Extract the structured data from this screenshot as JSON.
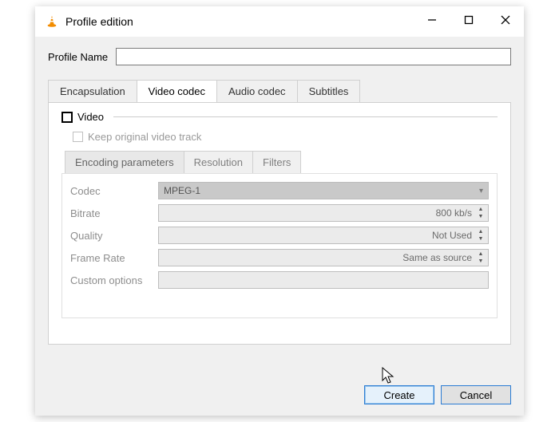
{
  "window": {
    "title": "Profile edition"
  },
  "profile": {
    "label": "Profile Name",
    "value": ""
  },
  "tabs": {
    "encapsulation": "Encapsulation",
    "video_codec": "Video codec",
    "audio_codec": "Audio codec",
    "subtitles": "Subtitles"
  },
  "video": {
    "checkbox_label": "Video",
    "keep_label": "Keep original video track",
    "subtabs": {
      "encoding": "Encoding parameters",
      "resolution": "Resolution",
      "filters": "Filters"
    },
    "params": {
      "codec": {
        "label": "Codec",
        "value": "MPEG-1"
      },
      "bitrate": {
        "label": "Bitrate",
        "value": "800 kb/s"
      },
      "quality": {
        "label": "Quality",
        "value": "Not Used"
      },
      "framerate": {
        "label": "Frame Rate",
        "value": "Same as source"
      },
      "custom": {
        "label": "Custom options",
        "value": ""
      }
    }
  },
  "buttons": {
    "create": "Create",
    "cancel": "Cancel"
  }
}
